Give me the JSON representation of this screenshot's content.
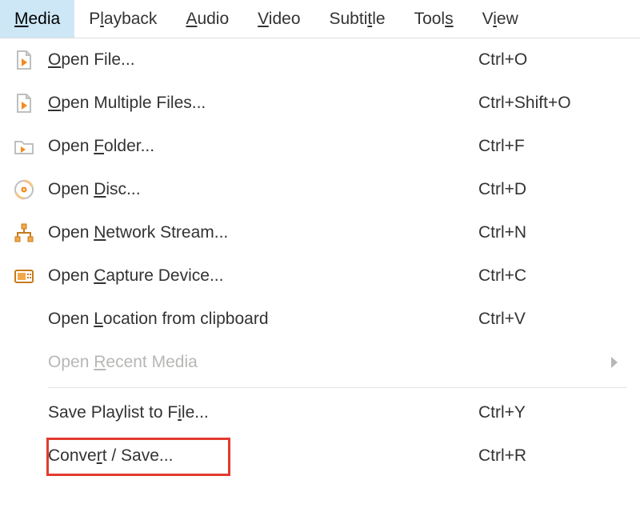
{
  "menubar": {
    "items": [
      {
        "pre": "",
        "mn": "M",
        "post": "edia",
        "active": true
      },
      {
        "pre": "P",
        "mn": "l",
        "post": "ayback"
      },
      {
        "pre": "",
        "mn": "A",
        "post": "udio"
      },
      {
        "pre": "",
        "mn": "V",
        "post": "ideo"
      },
      {
        "pre": "Subti",
        "mn": "t",
        "post": "le"
      },
      {
        "pre": "Tool",
        "mn": "s",
        "post": ""
      },
      {
        "pre": "V",
        "mn": "i",
        "post": "ew"
      }
    ]
  },
  "dropdown": {
    "items": [
      {
        "icon": "file-play",
        "pre": "",
        "mn": "O",
        "post": "pen File...",
        "shortcut": "Ctrl+O"
      },
      {
        "icon": "file-play",
        "pre": "",
        "mn": "O",
        "post": "pen Multiple Files...",
        "shortcut": "Ctrl+Shift+O"
      },
      {
        "icon": "folder-play",
        "pre": "Open ",
        "mn": "F",
        "post": "older...",
        "shortcut": "Ctrl+F"
      },
      {
        "icon": "disc",
        "pre": "Open ",
        "mn": "D",
        "post": "isc...",
        "shortcut": "Ctrl+D"
      },
      {
        "icon": "network",
        "pre": "Open ",
        "mn": "N",
        "post": "etwork Stream...",
        "shortcut": "Ctrl+N"
      },
      {
        "icon": "capture",
        "pre": "Open ",
        "mn": "C",
        "post": "apture Device...",
        "shortcut": "Ctrl+C"
      },
      {
        "icon": "",
        "pre": "Open ",
        "mn": "L",
        "post": "ocation from clipboard",
        "shortcut": "Ctrl+V"
      },
      {
        "icon": "",
        "pre": "Open ",
        "mn": "R",
        "post": "ecent Media",
        "shortcut": "",
        "disabled": true,
        "submenu": true
      },
      {
        "separator": true
      },
      {
        "icon": "",
        "pre": "Save Playlist to F",
        "mn": "i",
        "post": "le...",
        "shortcut": "Ctrl+Y"
      },
      {
        "icon": "",
        "pre": "Conve",
        "mn": "r",
        "post": "t / Save...",
        "shortcut": "Ctrl+R",
        "highlight": true
      }
    ]
  }
}
